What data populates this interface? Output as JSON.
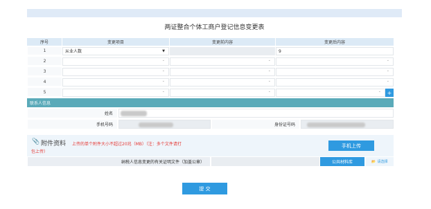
{
  "title": "两证整合个体工商户登记信息变更表",
  "table": {
    "headers": {
      "seq": "序号",
      "item": "变更项目",
      "before": "变更前内容",
      "after": "变更后内容"
    },
    "rows": [
      {
        "num": "1",
        "item": "从业人数",
        "after": "9"
      },
      {
        "num": "2",
        "item": "",
        "after": ""
      },
      {
        "num": "3",
        "item": "",
        "after": ""
      },
      {
        "num": "4",
        "item": "",
        "after": ""
      },
      {
        "num": "5",
        "item": "",
        "after": ""
      }
    ],
    "add_label": "+"
  },
  "contact": {
    "section_label": "联系人信息",
    "name_label": "姓名",
    "phone_label": "手机号码",
    "id_label": "身份证号码"
  },
  "attachments": {
    "title": "附件资料",
    "note_line1": "上传的单个附件大小不超过20兆（MB）（注：多个文件请打",
    "note_line2": "包上传）",
    "mobile_upload_label": "手机上传",
    "file_row_label": "纳税人信息变更的有关证明文件（加盖公章）",
    "public_library_label": "公共材料库",
    "choose_label": "请选择"
  },
  "submit_label": "提 交",
  "colors": {
    "accent": "#2f9ae0",
    "teal": "#5aaab9",
    "header_bg": "#dceaf6",
    "warn": "#e53935"
  }
}
